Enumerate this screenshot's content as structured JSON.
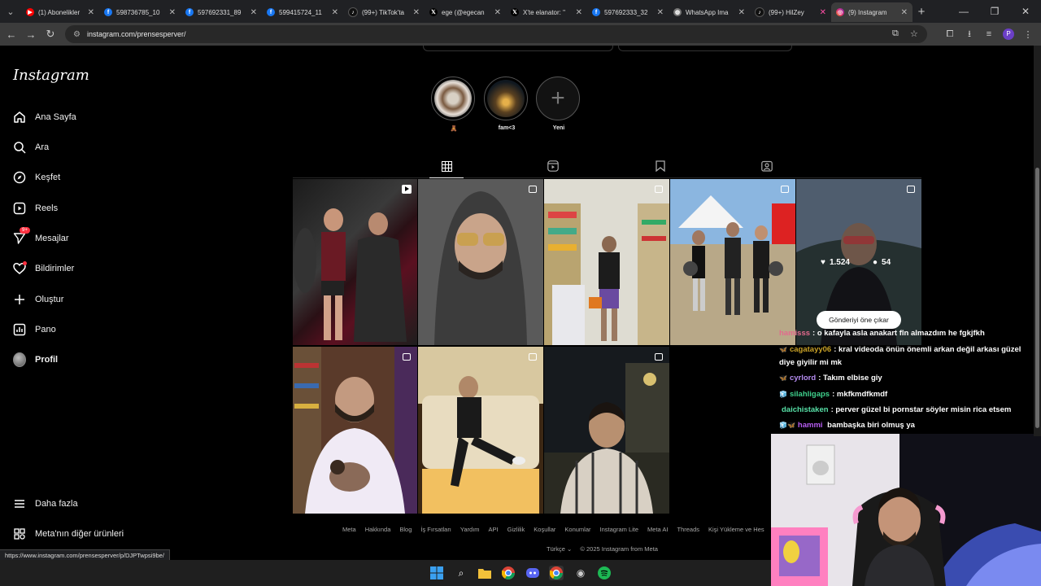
{
  "browser": {
    "tabs": [
      {
        "label": "(1) Abonelikler",
        "icon": "youtube-icon",
        "color": "#ff0000"
      },
      {
        "label": "598736785_10",
        "icon": "facebook-icon",
        "color": "#1877f2"
      },
      {
        "label": "597692331_89",
        "icon": "facebook-icon",
        "color": "#1877f2"
      },
      {
        "label": "599415724_11",
        "icon": "facebook-icon",
        "color": "#1877f2"
      },
      {
        "label": "(99+) TikTok'ta",
        "icon": "tiktok-icon",
        "color": "#000000"
      },
      {
        "label": "ege (@egecan",
        "icon": "x-icon",
        "color": "#000000"
      },
      {
        "label": "X'te elanator: \"",
        "icon": "x-icon",
        "color": "#000000"
      },
      {
        "label": "597692333_32",
        "icon": "facebook-icon",
        "color": "#1877f2"
      },
      {
        "label": "WhatsApp Ima",
        "icon": "globe-icon",
        "color": "#777777"
      },
      {
        "label": "(99+) HilZey",
        "icon": "tiktok-icon",
        "color": "#000000"
      },
      {
        "label": "(9) Instagram",
        "icon": "instagram-icon",
        "color": "#d6249f",
        "active": true
      }
    ],
    "url": "instagram.com/prensesperver/",
    "status_url": "https://www.instagram.com/prensesperver/p/DJPTwpsi9be/"
  },
  "sidebar": {
    "logo": "Instagram",
    "items": [
      {
        "label": "Ana Sayfa",
        "icon": "home-icon"
      },
      {
        "label": "Ara",
        "icon": "search-icon"
      },
      {
        "label": "Keşfet",
        "icon": "compass-icon"
      },
      {
        "label": "Reels",
        "icon": "reels-icon"
      },
      {
        "label": "Mesajlar",
        "icon": "messenger-icon",
        "badge": "9+"
      },
      {
        "label": "Bildirimler",
        "icon": "heart-icon"
      },
      {
        "label": "Oluştur",
        "icon": "plus-icon"
      },
      {
        "label": "Pano",
        "icon": "dashboard-icon"
      },
      {
        "label": "Profil",
        "icon": "avatar"
      }
    ],
    "bottom": [
      {
        "label": "Daha fazla",
        "icon": "menu-icon"
      },
      {
        "label": "Meta'nın diğer ürünleri",
        "icon": "grid-icon"
      }
    ]
  },
  "highlights": [
    {
      "caption": "🧸"
    },
    {
      "caption": "fam<3"
    },
    {
      "caption": "Yeni"
    }
  ],
  "hovered_post": {
    "likes": "1.524",
    "comments": "54"
  },
  "tooltip": "Gönderiyi öne çıkar",
  "chat": [
    {
      "user": "hamisss",
      "text": ": o kafayla asla anakart fln almazdım he fgkjfkh",
      "color": "#e26a8d"
    },
    {
      "user": "cagatayy06",
      "text": ": kral videoda önün önemli arkan değil arkası güzel",
      "text2": "diye giyilir mi mk",
      "color": "#c9a227",
      "emote": "🦋"
    },
    {
      "user": "cyrlord",
      "text": ": Takım elbise giy",
      "color": "#b58cf0",
      "emote": "🦋"
    },
    {
      "user": "silahligaps",
      "text": ": mkfkmdfkmdf",
      "color": "#3fd08c",
      "emote": "🧊"
    },
    {
      "user": "daichistaken",
      "text": ": perver güzel bi pornstar söyler misin rica etsem",
      "color": "#57e0a7"
    },
    {
      "user": "hammi",
      "text": " bambaşka biri olmuş ya",
      "color": "#b55cf0",
      "emote": "🧊🦋"
    }
  ],
  "footer": {
    "links": [
      "Meta",
      "Hakkında",
      "Blog",
      "İş Fırsatları",
      "Yardım",
      "API",
      "Gizlilik",
      "Koşullar",
      "Konumlar",
      "Instagram Lite",
      "Meta AI",
      "Threads",
      "Kişi Yükleme ve Hes"
    ],
    "language": "Türkçe",
    "copyright": "© 2025 Instagram from Meta"
  }
}
